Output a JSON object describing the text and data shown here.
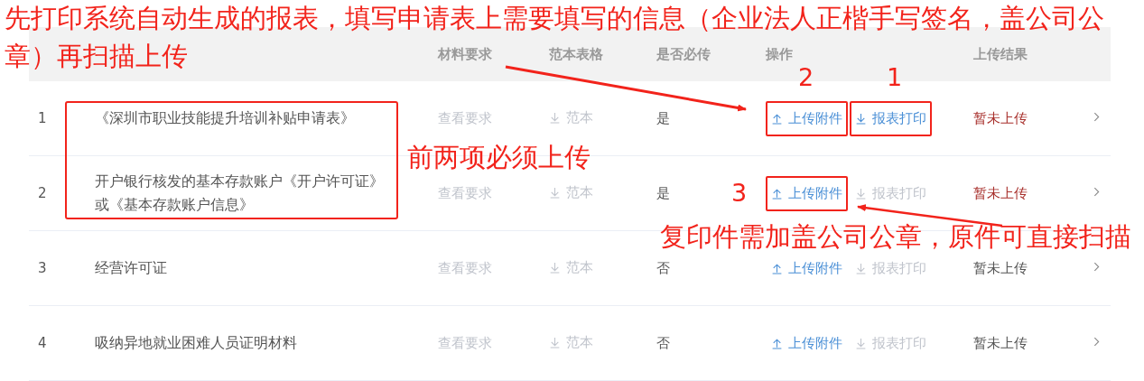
{
  "table": {
    "columns": [
      {
        "label": "材料要求"
      },
      {
        "label": "范本表格"
      },
      {
        "label": "是否必传"
      },
      {
        "label": "操作"
      },
      {
        "label": "上传结果"
      }
    ],
    "rows": [
      {
        "index": "1",
        "name": "《深圳市职业技能提升培训补贴申请表》",
        "requirement": "查看要求",
        "sample": "范本",
        "required": "是",
        "upload": {
          "label": "上传附件",
          "disabled": false,
          "boxed": true
        },
        "print": {
          "label": "报表打印",
          "disabled": false,
          "boxed": true
        },
        "status": {
          "text": "暂未上传",
          "color": "#a8302c"
        }
      },
      {
        "index": "2",
        "name": "开户银行核发的基本存款账户《开户许可证》或《基本存款账户信息》",
        "requirement": "查看要求",
        "sample": "范本",
        "required": "是",
        "upload": {
          "label": "上传附件",
          "disabled": false,
          "boxed": true
        },
        "print": {
          "label": "报表打印",
          "disabled": true,
          "boxed": false
        },
        "status": {
          "text": "暂未上传",
          "color": "#a8302c"
        }
      },
      {
        "index": "3",
        "name": "经营许可证",
        "requirement": "查看要求",
        "sample": "范本",
        "required": "否",
        "upload": {
          "label": "上传附件",
          "disabled": false,
          "boxed": false
        },
        "print": {
          "label": "报表打印",
          "disabled": true,
          "boxed": false
        },
        "status": {
          "text": "暂未上传",
          "color": "#555555"
        }
      },
      {
        "index": "4",
        "name": "吸纳异地就业困难人员证明材料",
        "requirement": "查看要求",
        "sample": "范本",
        "required": "否",
        "upload": {
          "label": "上传附件",
          "disabled": false,
          "boxed": false
        },
        "print": {
          "label": "报表打印",
          "disabled": true,
          "boxed": false
        },
        "status": {
          "text": "暂未上传",
          "color": "#555555"
        }
      }
    ]
  },
  "annotations": [
    {
      "kind": "note",
      "text": "先打印系统自动生成的报表，填写申请表上需要填写的信息（企业法人正楷手写签名，盖公司公"
    },
    {
      "kind": "note",
      "text": "章）再扫描上传"
    },
    {
      "kind": "note",
      "text": "前两项必须上传"
    },
    {
      "kind": "note",
      "text": "复印件需加盖公司公章，原件可直接扫描"
    },
    {
      "kind": "number",
      "text": "2"
    },
    {
      "kind": "number",
      "text": "1"
    },
    {
      "kind": "number",
      "text": "3"
    }
  ]
}
